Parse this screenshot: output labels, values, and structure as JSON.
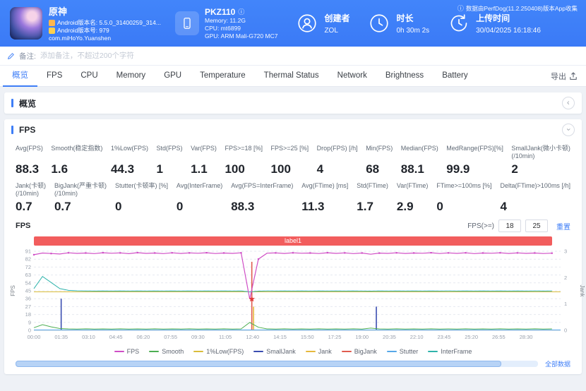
{
  "header": {
    "app_title": "原神",
    "android_version_name": "Android版本名: 5.5.0_31400259_314...",
    "android_version_code": "Android版本号: 979",
    "package_name": "com.miHoYo.Yuanshen",
    "device": {
      "name": "PKZ110",
      "memory": "Memory: 11.2G",
      "cpu": "CPU: mt6899",
      "gpu": "GPU: ARM Mali-G720 MC7"
    },
    "creator": {
      "label": "创建者",
      "value": "ZOL"
    },
    "duration": {
      "label": "时长",
      "value": "0h 30m 2s"
    },
    "upload_time": {
      "label": "上传时间",
      "value": "30/04/2025 16:18:46"
    },
    "collect_note": "数据由PerfDog(11.2.250408)版本App收集"
  },
  "icons": {
    "info": "ⓘ",
    "chevron": "›"
  },
  "remark": {
    "label": "备注:",
    "placeholder": "添加备注，不超过200个字符"
  },
  "tabs": {
    "items": [
      "概览",
      "FPS",
      "CPU",
      "Memory",
      "GPU",
      "Temperature",
      "Thermal Status",
      "Network",
      "Brightness",
      "Battery"
    ],
    "active_index": 0,
    "export_label": "导出"
  },
  "overview_section": {
    "title": "概览"
  },
  "fps_section": {
    "title": "FPS",
    "chart_title": "FPS",
    "threshold_label": "FPS(>=)",
    "threshold_low": "18",
    "threshold_high": "25",
    "reset_label": "重置",
    "banner_label": "label1",
    "all_data_label": "全部数据"
  },
  "metrics": {
    "row1": [
      {
        "label": "Avg(FPS)",
        "value": "88.3"
      },
      {
        "label": "Smooth(稳定指数)",
        "value": "1.6"
      },
      {
        "label": "1%Low(FPS)",
        "value": "44.3"
      },
      {
        "label": "Std(FPS)",
        "value": "1"
      },
      {
        "label": "Var(FPS)",
        "value": "1.1"
      },
      {
        "label": "FPS>=18 [%]",
        "value": "100"
      },
      {
        "label": "FPS>=25 [%]",
        "value": "100"
      },
      {
        "label": "Drop(FPS) [/h]",
        "value": "4"
      },
      {
        "label": "Min(FPS)",
        "value": "68"
      },
      {
        "label": "Median(FPS)",
        "value": "88.1"
      },
      {
        "label": "MedRange(FPS)[%]",
        "value": "99.9"
      },
      {
        "label": "SmallJank(微小卡顿)\n(/10min)",
        "value": "2"
      }
    ],
    "row2": [
      {
        "label": "Jank(卡顿)\n(/10min)",
        "value": "0.7"
      },
      {
        "label": "BigJank(严重卡顿)\n(/10min)",
        "value": "0.7"
      },
      {
        "label": "Stutter(卡顿率) [%]",
        "value": "0"
      },
      {
        "label": "Avg(InterFrame)",
        "value": "0"
      },
      {
        "label": "Avg(FPS=InterFrame)",
        "value": "88.3"
      },
      {
        "label": "Avg(FTime) [ms]",
        "value": "11.3"
      },
      {
        "label": "Std(FTime)",
        "value": "1.7"
      },
      {
        "label": "Var(FTime)",
        "value": "2.9"
      },
      {
        "label": "FTime>=100ms [%]",
        "value": "0"
      },
      {
        "label": "Delta(FTime)>100ms [/h]",
        "value": "4"
      }
    ]
  },
  "chart_data": {
    "type": "line",
    "title": "FPS",
    "x_start": 0,
    "x_step": 0.5,
    "x_max": 30.5,
    "x_tick_seconds": 95,
    "x_ticks": [
      "00:00",
      "01:35",
      "03:10",
      "04:45",
      "06:20",
      "07:55",
      "09:30",
      "11:05",
      "12:40",
      "14:15",
      "15:50",
      "17:25",
      "19:00",
      "20:35",
      "22:10",
      "23:45",
      "25:20",
      "26:55",
      "28:30"
    ],
    "y_left": {
      "label": "FPS",
      "max": 91,
      "ticks": [
        0,
        9,
        18,
        27,
        36,
        45,
        54,
        63,
        72,
        82,
        91
      ]
    },
    "y_right": {
      "label": "Jank",
      "max": 3,
      "ticks": [
        0,
        1,
        2,
        3
      ]
    },
    "series": [
      {
        "name": "Stutter",
        "color": "#57a8e8",
        "width": 1,
        "x": [
          0,
          30.5
        ],
        "y": [
          0.4,
          0.4
        ]
      },
      {
        "name": "1%Low(FPS)",
        "color": "#d9bc3a",
        "width": 1,
        "x": [
          0,
          30.5
        ],
        "y": [
          44.3,
          44.3
        ]
      },
      {
        "name": "InterFrame",
        "color": "#2fb3ab",
        "width": 1,
        "y": [
          48,
          62,
          55,
          48,
          46,
          45.5,
          45.3,
          45.2,
          45.3,
          45.2,
          45.3,
          45.2,
          45.3,
          45.2,
          45.3,
          45.2,
          45.3,
          45.2,
          45.3,
          45.2,
          45.3,
          45.2,
          45.3,
          45.2,
          45.3,
          44.2,
          45.1,
          45.3,
          45.2,
          45.3,
          45.2,
          45.3,
          45.2,
          45.3,
          45.2,
          45.3,
          45.2,
          45.3,
          45.2,
          45.1,
          45.3,
          45.2,
          45.3,
          45.2,
          45.3,
          45.2,
          45.3,
          45.2,
          45.3,
          45.2,
          45.3,
          45.2,
          45.3,
          45.2,
          45.3,
          45.2,
          45.3,
          45.2,
          45.3,
          45.2,
          45.3
        ]
      },
      {
        "name": "Smooth",
        "color": "#4cae52",
        "width": 1,
        "y": [
          3,
          6.5,
          4,
          2,
          1.6,
          1.5,
          1.7,
          1.5,
          1.6,
          1.5,
          1.7,
          1.5,
          1.6,
          1.5,
          1.7,
          1.5,
          1.6,
          1.5,
          1.7,
          1.5,
          1.6,
          1.5,
          1.7,
          1.5,
          1.6,
          9,
          3.5,
          1.6,
          1.5,
          1.7,
          1.5,
          1.6,
          1.5,
          1.7,
          1.5,
          1.6,
          1.5,
          1.7,
          1.5,
          2.5,
          1.6,
          1.5,
          1.7,
          1.5,
          1.6,
          1.5,
          1.7,
          1.5,
          1.6,
          1.5,
          1.7,
          1.5,
          1.6,
          1.5,
          1.7,
          1.5,
          1.6,
          1.5,
          1.7,
          1.5,
          1.6
        ]
      },
      {
        "name": "FPS",
        "color": "#cf4ec6",
        "width": 1.2,
        "markers": true,
        "y": [
          87,
          89,
          88.4,
          87.8,
          89.2,
          88.6,
          89,
          88.3,
          89.3,
          88.7,
          89.1,
          88.2,
          89.4,
          88.6,
          89,
          88.3,
          89.2,
          88.5,
          89.1,
          88.7,
          89.3,
          88.4,
          89,
          88.6,
          89.2,
          36,
          82,
          88.8,
          89.1,
          88.5,
          89.2,
          88.7,
          89,
          88.4,
          89.3,
          88.6,
          89.1,
          88.3,
          89,
          87.6,
          88.9,
          88.6,
          89.2,
          88.5,
          89,
          88.7,
          89.3,
          88.4,
          89.1,
          88.6,
          89.2,
          88.3,
          89,
          88.7,
          89.2,
          88.5,
          89.1,
          88.6,
          89,
          88.4,
          88.8
        ]
      }
    ],
    "jank_events": [
      {
        "x": 1.58,
        "type": "SmallJank",
        "color": "#3a4db0",
        "count": 1.2
      },
      {
        "x": 12.62,
        "type": "BigJank",
        "color": "#e05b4f",
        "count": 2.6
      },
      {
        "x": 12.72,
        "type": "Jank",
        "color": "#e6b93d",
        "count": 0.9
      },
      {
        "x": 19.83,
        "type": "SmallJank",
        "color": "#3a4db0",
        "count": 0.9
      }
    ],
    "event_markers": [
      {
        "x": 12.62,
        "y": 36,
        "type": "BigJank",
        "color": "#e03b3b"
      }
    ],
    "legend": [
      {
        "label": "FPS",
        "color": "#cf4ec6"
      },
      {
        "label": "Smooth",
        "color": "#4cae52"
      },
      {
        "label": "1%Low(FPS)",
        "color": "#d9bc3a"
      },
      {
        "label": "SmallJank",
        "color": "#3a4db0"
      },
      {
        "label": "Jank",
        "color": "#e6b93d"
      },
      {
        "label": "BigJank",
        "color": "#e05b4f"
      },
      {
        "label": "Stutter",
        "color": "#57a8e8"
      },
      {
        "label": "InterFrame",
        "color": "#2fb3ab"
      }
    ]
  }
}
